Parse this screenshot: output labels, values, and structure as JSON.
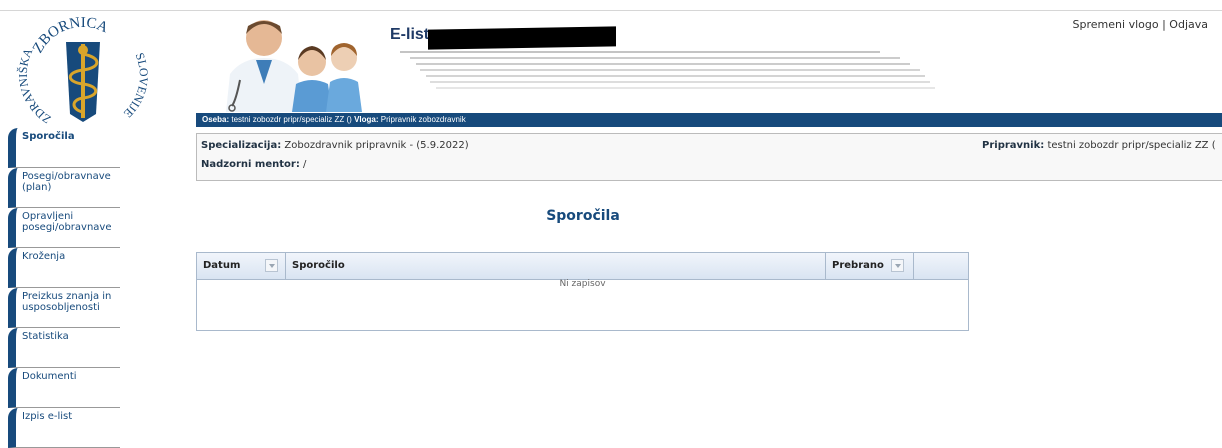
{
  "header": {
    "title": "E-list",
    "logo_text_top": "ZBORNICA",
    "logo_text_left": "ZDRAVNIŠKA",
    "logo_text_right": "SLOVENIJE",
    "links": {
      "change_role": "Spremeni vlogo",
      "separator": "|",
      "logout": "Odjava"
    }
  },
  "bar": {
    "oseba_label": "Oseba:",
    "oseba_value": "testni zobozdr pripr/specializ ZZ ()",
    "vloga_label": "Vloga:",
    "vloga_value": "Pripravnik zobozdravnik"
  },
  "info": {
    "spec_label": "Specializacija:",
    "spec_value": "Zobozdravnik pripravnik - (5.9.2022)",
    "mentor_label": "Nadzorni mentor:",
    "mentor_value": "/",
    "prip_label": "Pripravnik:",
    "prip_value": "testni zobozdr pripr/specializ ZZ ("
  },
  "main": {
    "heading": "Sporočila",
    "table": {
      "columns": [
        "Datum",
        "Sporočilo",
        "Prebrano"
      ],
      "empty_text": "Ni zapisov"
    }
  },
  "sidebar": {
    "items": [
      {
        "label_lines": [
          "Sporočila"
        ],
        "active": true
      },
      {
        "label_lines": [
          "Posegi/obravnave",
          "(plan)"
        ],
        "active": false
      },
      {
        "label_lines": [
          "Opravljeni",
          "posegi/obravnave"
        ],
        "active": false
      },
      {
        "label_lines": [
          "Kroženja"
        ],
        "active": false
      },
      {
        "label_lines": [
          "Preizkus znanja in",
          "usposobljenosti"
        ],
        "active": false
      },
      {
        "label_lines": [
          "Statistika"
        ],
        "active": false
      },
      {
        "label_lines": [
          "Dokumenti"
        ],
        "active": false
      },
      {
        "label_lines": [
          "Izpis e-list"
        ],
        "active": false
      }
    ]
  },
  "colors": {
    "brand": "#174a7c",
    "gold": "#d9a52a"
  }
}
